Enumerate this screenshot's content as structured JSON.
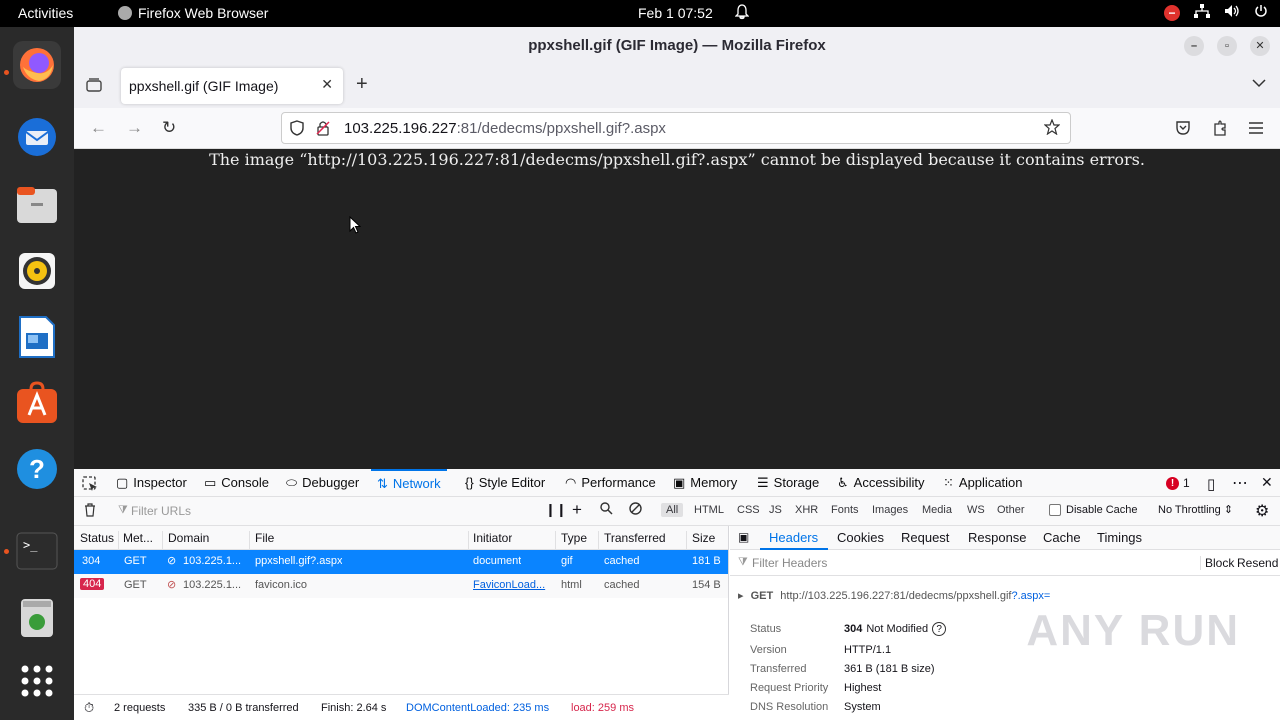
{
  "topbar": {
    "activities": "Activities",
    "app_name": "Firefox Web Browser",
    "clock": "Feb 1  07:52"
  },
  "window": {
    "title": "ppxshell.gif (GIF Image) — Mozilla Firefox"
  },
  "tabs": [
    {
      "label": "ppxshell.gif (GIF Image)"
    }
  ],
  "urlbar": {
    "host": "103.225.196.227",
    "rest": ":81/dedecms/ppxshell.gif?.aspx"
  },
  "content": {
    "error_text": "The image “http://103.225.196.227:81/dedecms/ppxshell.gif?.aspx” cannot be displayed because it contains errors."
  },
  "devtools": {
    "tabs": [
      "Inspector",
      "Console",
      "Debugger",
      "Network",
      "Style Editor",
      "Performance",
      "Memory",
      "Storage",
      "Accessibility",
      "Application"
    ],
    "error_count": "1",
    "filter_placeholder": "Filter URLs",
    "type_filters": [
      "All",
      "HTML",
      "CSS",
      "JS",
      "XHR",
      "Fonts",
      "Images",
      "Media",
      "WS",
      "Other"
    ],
    "disable_cache": "Disable Cache",
    "throttling": "No Throttling ⇕",
    "columns": [
      "Status",
      "Met...",
      "Domain",
      "File",
      "Initiator",
      "Type",
      "Transferred",
      "Size"
    ],
    "rows": [
      {
        "status": "304",
        "method": "GET",
        "domain": "103.225.1...",
        "file": "ppxshell.gif?.aspx",
        "initiator": "document",
        "type": "gif",
        "transferred": "cached",
        "size": "181 B"
      },
      {
        "status": "404",
        "method": "GET",
        "domain": "103.225.1...",
        "file": "favicon.ico",
        "initiator": "FaviconLoad...",
        "type": "html",
        "transferred": "cached",
        "size": "154 B"
      }
    ],
    "status": {
      "requests": "2 requests",
      "transferred": "335 B / 0 B transferred",
      "finish": "Finish: 2.64 s",
      "dcl": "DOMContentLoaded: 235 ms",
      "load": "load: 259 ms"
    },
    "detail_tabs": [
      "Headers",
      "Cookies",
      "Request",
      "Response",
      "Cache",
      "Timings"
    ],
    "detail_filter": "Filter Headers",
    "block": "Block",
    "resend": "Resend",
    "request_line_method": "GET",
    "request_line_url": "http://103.225.196.227:81/dedecms/ppxshell.gif",
    "request_line_query": "?.aspx=",
    "headers": [
      {
        "k": "Status",
        "v": "Not Modified",
        "code": "304"
      },
      {
        "k": "Version",
        "v": "HTTP/1.1"
      },
      {
        "k": "Transferred",
        "v": "361 B (181 B size)"
      },
      {
        "k": "Request Priority",
        "v": "Highest"
      },
      {
        "k": "DNS Resolution",
        "v": "System"
      }
    ],
    "watermark": "ANY RUN"
  }
}
